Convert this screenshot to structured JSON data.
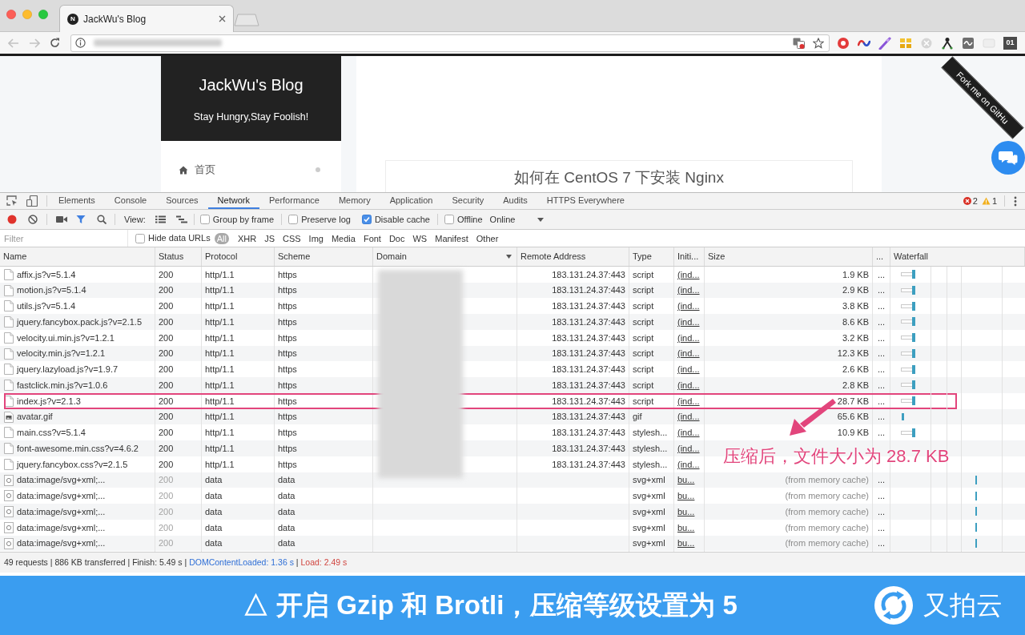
{
  "browser": {
    "tab": {
      "icon_letter": "N",
      "title": "JackWu's Blog"
    },
    "extension_badge": "01"
  },
  "page": {
    "blog_title": "JackWu's Blog",
    "blog_subtitle": "Stay Hungry,Stay Foolish!",
    "menu": [
      {
        "label": "首页"
      }
    ],
    "article_title": "如何在 CentOS 7 下安装 Nginx",
    "ribbon": "Fork me on GitHu"
  },
  "devtools": {
    "tabs": [
      {
        "label": "Elements",
        "selected": false
      },
      {
        "label": "Console",
        "selected": false
      },
      {
        "label": "Sources",
        "selected": false
      },
      {
        "label": "Network",
        "selected": true
      },
      {
        "label": "Performance",
        "selected": false
      },
      {
        "label": "Memory",
        "selected": false
      },
      {
        "label": "Application",
        "selected": false
      },
      {
        "label": "Security",
        "selected": false
      },
      {
        "label": "Audits",
        "selected": false
      },
      {
        "label": "HTTPS Everywhere",
        "selected": false
      }
    ],
    "errors": "2",
    "warnings": "1",
    "toolbar": {
      "recording": true,
      "filter_active": true,
      "view_label": "View:",
      "options": [
        {
          "label": "Group by frame",
          "checked": false
        },
        {
          "label": "Preserve log",
          "checked": false
        },
        {
          "label": "Disable cache",
          "checked": true
        },
        {
          "label": "Offline",
          "checked": false
        }
      ],
      "throttling": "Online"
    },
    "filter_bar": {
      "placeholder": "Filter",
      "hide_data_urls": {
        "label": "Hide data URLs",
        "checked": false
      },
      "types": [
        {
          "label": "All",
          "selected": true
        },
        {
          "label": "XHR",
          "selected": false
        },
        {
          "label": "JS",
          "selected": false
        },
        {
          "label": "CSS",
          "selected": false
        },
        {
          "label": "Img",
          "selected": false
        },
        {
          "label": "Media",
          "selected": false
        },
        {
          "label": "Font",
          "selected": false
        },
        {
          "label": "Doc",
          "selected": false
        },
        {
          "label": "WS",
          "selected": false
        },
        {
          "label": "Manifest",
          "selected": false
        },
        {
          "label": "Other",
          "selected": false
        }
      ]
    },
    "table": {
      "columns": [
        {
          "label": "Name",
          "sorted": false
        },
        {
          "label": "Status",
          "sorted": false
        },
        {
          "label": "Protocol",
          "sorted": false
        },
        {
          "label": "Scheme",
          "sorted": false
        },
        {
          "label": "Domain",
          "sorted": true
        },
        {
          "label": "Remote Address",
          "sorted": false
        },
        {
          "label": "Type",
          "sorted": false
        },
        {
          "label": "Initi...",
          "sorted": false
        },
        {
          "label": "Size",
          "sorted": false
        },
        {
          "label": "...",
          "sorted": false
        },
        {
          "label": "Waterfall",
          "sorted": false
        }
      ],
      "rows": [
        {
          "kind": "file",
          "highlighted": false,
          "name": "affix.js?v=5.1.4",
          "status": "200",
          "protocol": "http/1.1",
          "scheme": "https",
          "remote_address": "183.131.24.37:443",
          "type": "script",
          "initiator": "(ind...",
          "size": "1.9 KB",
          "column_10": "..."
        },
        {
          "kind": "file",
          "highlighted": false,
          "name": "motion.js?v=5.1.4",
          "status": "200",
          "protocol": "http/1.1",
          "scheme": "https",
          "remote_address": "183.131.24.37:443",
          "type": "script",
          "initiator": "(ind...",
          "size": "2.9 KB",
          "column_10": "..."
        },
        {
          "kind": "file",
          "highlighted": false,
          "name": "utils.js?v=5.1.4",
          "status": "200",
          "protocol": "http/1.1",
          "scheme": "https",
          "remote_address": "183.131.24.37:443",
          "type": "script",
          "initiator": "(ind...",
          "size": "3.8 KB",
          "column_10": "..."
        },
        {
          "kind": "file",
          "highlighted": false,
          "name": "jquery.fancybox.pack.js?v=2.1.5",
          "status": "200",
          "protocol": "http/1.1",
          "scheme": "https",
          "remote_address": "183.131.24.37:443",
          "type": "script",
          "initiator": "(ind...",
          "size": "8.6 KB",
          "column_10": "..."
        },
        {
          "kind": "file",
          "highlighted": false,
          "name": "velocity.ui.min.js?v=1.2.1",
          "status": "200",
          "protocol": "http/1.1",
          "scheme": "https",
          "remote_address": "183.131.24.37:443",
          "type": "script",
          "initiator": "(ind...",
          "size": "3.2 KB",
          "column_10": "..."
        },
        {
          "kind": "file",
          "highlighted": false,
          "name": "velocity.min.js?v=1.2.1",
          "status": "200",
          "protocol": "http/1.1",
          "scheme": "https",
          "remote_address": "183.131.24.37:443",
          "type": "script",
          "initiator": "(ind...",
          "size": "12.3 KB",
          "column_10": "..."
        },
        {
          "kind": "file",
          "highlighted": false,
          "name": "jquery.lazyload.js?v=1.9.7",
          "status": "200",
          "protocol": "http/1.1",
          "scheme": "https",
          "remote_address": "183.131.24.37:443",
          "type": "script",
          "initiator": "(ind...",
          "size": "2.6 KB",
          "column_10": "..."
        },
        {
          "kind": "file",
          "highlighted": false,
          "name": "fastclick.min.js?v=1.0.6",
          "status": "200",
          "protocol": "http/1.1",
          "scheme": "https",
          "remote_address": "183.131.24.37:443",
          "type": "script",
          "initiator": "(ind...",
          "size": "2.8 KB",
          "column_10": "..."
        },
        {
          "kind": "file",
          "highlighted": true,
          "name": "index.js?v=2.1.3",
          "status": "200",
          "protocol": "http/1.1",
          "scheme": "https",
          "remote_address": "183.131.24.37:443",
          "type": "script",
          "initiator": "(ind...",
          "size": "28.7 KB",
          "column_10": "..."
        },
        {
          "kind": "image",
          "highlighted": false,
          "name": "avatar.gif",
          "status": "200",
          "protocol": "http/1.1",
          "scheme": "https",
          "remote_address": "183.131.24.37:443",
          "type": "gif",
          "initiator": "(ind...",
          "size": "65.6 KB",
          "column_10": "..."
        },
        {
          "kind": "file",
          "highlighted": false,
          "name": "main.css?v=5.1.4",
          "status": "200",
          "protocol": "http/1.1",
          "scheme": "https",
          "remote_address": "183.131.24.37:443",
          "type": "stylesh...",
          "initiator": "(ind...",
          "size": "10.9 KB",
          "column_10": "..."
        },
        {
          "kind": "file",
          "highlighted": false,
          "name": "font-awesome.min.css?v=4.6.2",
          "status": "200",
          "protocol": "http/1.1",
          "scheme": "https",
          "remote_address": "183.131.24.37:443",
          "type": "stylesh...",
          "initiator": "(ind..."
        },
        {
          "kind": "file",
          "highlighted": false,
          "name": "jquery.fancybox.css?v=2.1.5",
          "status": "200",
          "protocol": "http/1.1",
          "scheme": "https",
          "remote_address": "183.131.24.37:443",
          "type": "stylesh...",
          "initiator": "(ind..."
        },
        {
          "kind": "data",
          "highlighted": false,
          "name": "data:image/svg+xml;...",
          "status": "200",
          "protocol": "data",
          "scheme": "data",
          "type": "svg+xml",
          "initiator": "bu...",
          "size": "(from memory cache)",
          "column_10": "..."
        },
        {
          "kind": "data",
          "highlighted": false,
          "name": "data:image/svg+xml;...",
          "status": "200",
          "protocol": "data",
          "scheme": "data",
          "type": "svg+xml",
          "initiator": "bu...",
          "size": "(from memory cache)",
          "column_10": "..."
        },
        {
          "kind": "data",
          "highlighted": false,
          "name": "data:image/svg+xml;...",
          "status": "200",
          "protocol": "data",
          "scheme": "data",
          "type": "svg+xml",
          "initiator": "bu...",
          "size": "(from memory cache)",
          "column_10": "..."
        },
        {
          "kind": "data",
          "highlighted": false,
          "name": "data:image/svg+xml;...",
          "status": "200",
          "protocol": "data",
          "scheme": "data",
          "type": "svg+xml",
          "initiator": "bu...",
          "size": "(from memory cache)",
          "column_10": "..."
        },
        {
          "kind": "data",
          "highlighted": false,
          "name": "data:image/svg+xml;...",
          "status": "200",
          "protocol": "data",
          "scheme": "data",
          "type": "svg+xml",
          "initiator": "bu...",
          "size": "(from memory cache)",
          "column_10": "..."
        }
      ]
    },
    "status_bar": [
      {
        "text": "49 requests | 886 KB transferred | Finish: 5.49 s | ",
        "kind": "plain"
      },
      {
        "text": "DOMContentLoaded: 1.36 s",
        "kind": "dom"
      },
      {
        "text": " | ",
        "kind": "plain"
      },
      {
        "text": "Load: 2.49 s",
        "kind": "load"
      }
    ]
  },
  "annotation": {
    "text": "压缩后，文件大小为 28.7 KB"
  },
  "caption": {
    "text": "△ 开启 Gzip 和 Brotli，压缩等级设置为 5",
    "logo_text": "又拍云"
  }
}
